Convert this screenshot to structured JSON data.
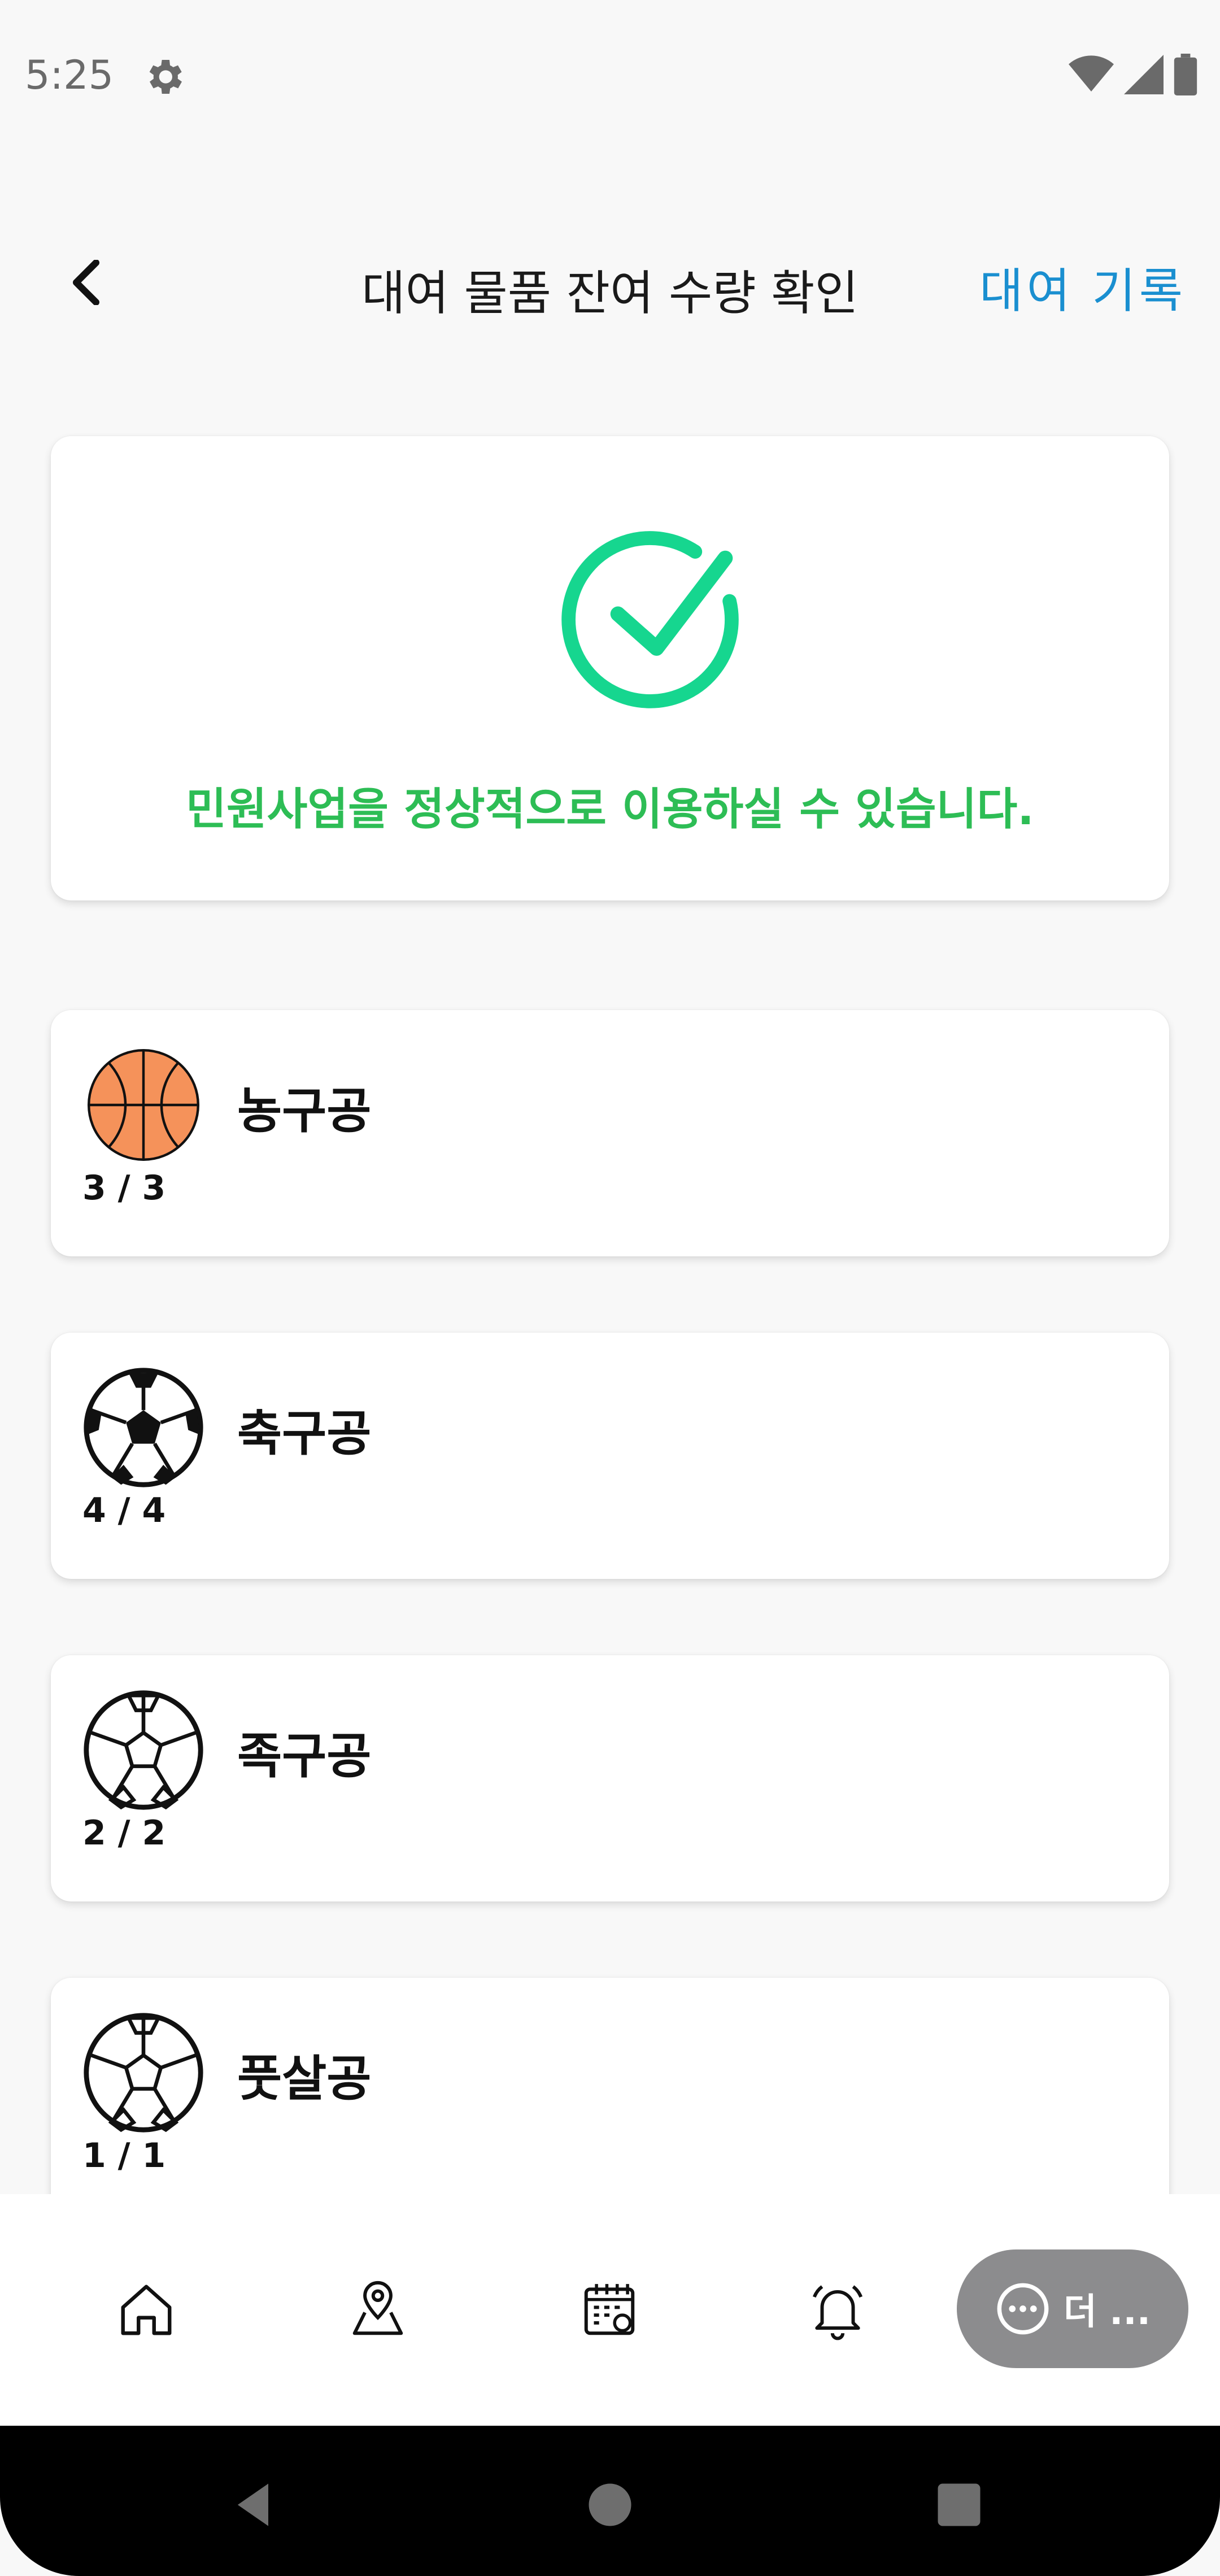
{
  "status_bar": {
    "time": "5:25"
  },
  "header": {
    "title": "대여 물품 잔여 수량 확인",
    "history_link": "대여 기록"
  },
  "status_card": {
    "message": "민원사업을 정상적으로 이용하실 수 있습니다.",
    "accent_color": "#16d68f",
    "message_color": "#2dbd55"
  },
  "items": [
    {
      "name": "농구공",
      "count": "3 / 3",
      "icon": "basketball-icon"
    },
    {
      "name": "축구공",
      "count": "4 / 4",
      "icon": "soccer-ball-icon"
    },
    {
      "name": "족구공",
      "count": "2 / 2",
      "icon": "jokgu-ball-icon"
    },
    {
      "name": "풋살공",
      "count": "1 / 1",
      "icon": "futsal-ball-icon"
    }
  ],
  "bottom_nav": {
    "items": [
      "home-icon",
      "map-pin-icon",
      "calendar-icon",
      "bell-icon"
    ],
    "more_label": "더 ..."
  }
}
